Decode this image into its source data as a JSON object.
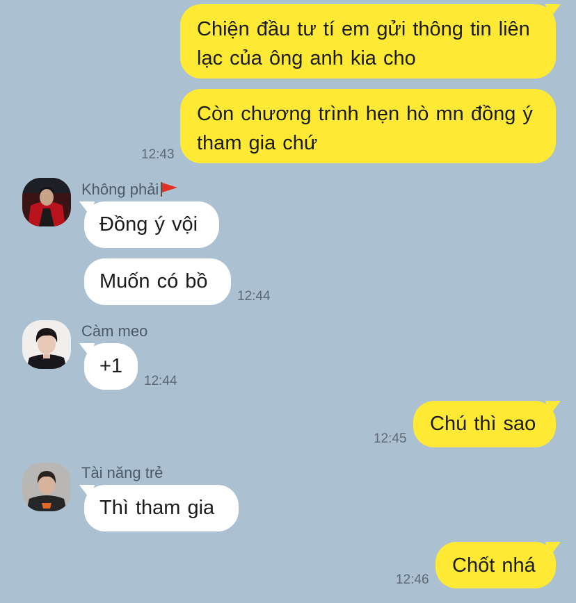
{
  "messages": {
    "m1": {
      "text": "Chiện đầu tư tí em gửi thông tin liên lạc của ông anh kia cho"
    },
    "m2": {
      "text": "Còn chương trình hẹn hò mn đồng ý tham gia chứ",
      "time": "12:43"
    },
    "m3": {
      "sender": "Không phải",
      "text": "Đồng ý vội"
    },
    "m4": {
      "text": "Muốn có bồ",
      "time": "12:44"
    },
    "m5": {
      "sender": "Càm meo",
      "text": "+1",
      "time": "12:44"
    },
    "m6": {
      "text": "Chú thì sao",
      "time": "12:45"
    },
    "m7": {
      "sender": "Tài năng trẻ",
      "text": "Thì tham gia"
    },
    "m8": {
      "text": "Chốt nhá",
      "time": "12:46"
    }
  },
  "colors": {
    "background": "#abc1d1",
    "outgoing_bubble": "#fee934",
    "incoming_bubble": "#ffffff",
    "timestamp": "#5d6a75"
  },
  "icons": {
    "sender_flag": "red-flag-icon"
  }
}
